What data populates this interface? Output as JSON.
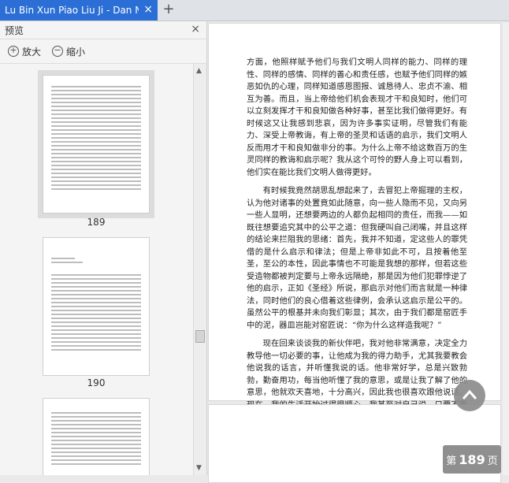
{
  "tab": {
    "title": "Lu Bin Xun Piao Liu Ji - Dan N",
    "close": "×",
    "new_tab": "+"
  },
  "sidebar": {
    "title": "预览",
    "close": "×",
    "zoom_in": "放大",
    "zoom_out": "缩小",
    "pages": [
      "189",
      "190"
    ]
  },
  "content": {
    "paragraphs": [
      "方面，他照样赋予他们与我们文明人同样的能力、同样的理性、同样的感情、同样的善心和责任感，也赋予他们同样的嫉恶如仇的心理，同样知道感恩图报、诚恳待人、忠贞不渝、相互为善。而且，当上帝给他们机会表现才干和良知时，他们可以立刻发挥才干和良知做各种好事，甚至比我们做得更好。有时候这又让我感到悲哀，因为许多事实证明，尽管我们有能力、深受上帝教诲，有上帝的圣灵和话语的启示，我们文明人反而用才干和良知做非分的事。为什么上帝不给这数百万的生灵同样的教诲和启示呢？我从这个可怜的野人身上可以看到，他们实在能比我们文明人做得更好。",
      "有时候我竟然胡思乱想起来了，去冒犯上帝掘理的主权，认为他对诸事的处置竟如此随意，向一些人隐而不见，又向另一些人显明，还想要两边的人都负起相同的责任，而我——如既往想要追究其中的公平之道：但我硬叫自己闭嘴，并且这样的结论来拦阻我的思绪：首先，我并不知道，定这些人的罪凭借的是什么启示和律法；但是上帝非如此不可，且按着他至圣，至公的本性，因此事情也不可能是我想的那样，但若这些受造物都被判定要与上帝永远隔绝，那是因为他们犯罪悖逆了他的启示，正如《圣经》所说，那启示对他们而言就是一种律法，同时他们的良心借着这些律例，会承认这启示是公平的。虽然公平的根基并未向我们彰显；其次，由于我们都是窑匠手中的泥，器皿岂能对窑匠说：“你为什么这样造我呢？”",
      "现在回来谈谈我的新伙伴吧，我对他非常满意，决定全力教导他一切必要的事，让他成为我的得力助手，尤其我要教会他说我的话言，并听懂我说的话。他非常好学，总是兴致勃勃，勤奋用功，每当他听懂了我的意思，或是让我了解了他的意思，他就欢天喜地，十分高兴，因此我也很喜欢跟他说话。现在，我的生活开始过得很顺心，我甚至对自己说，只要不再碰到那群吃人的野人，哪怕永远不离开这里，我也不在乎。"
    ],
    "page_label_prefix": "第",
    "page_number": "189",
    "page_label_suffix": "页"
  }
}
